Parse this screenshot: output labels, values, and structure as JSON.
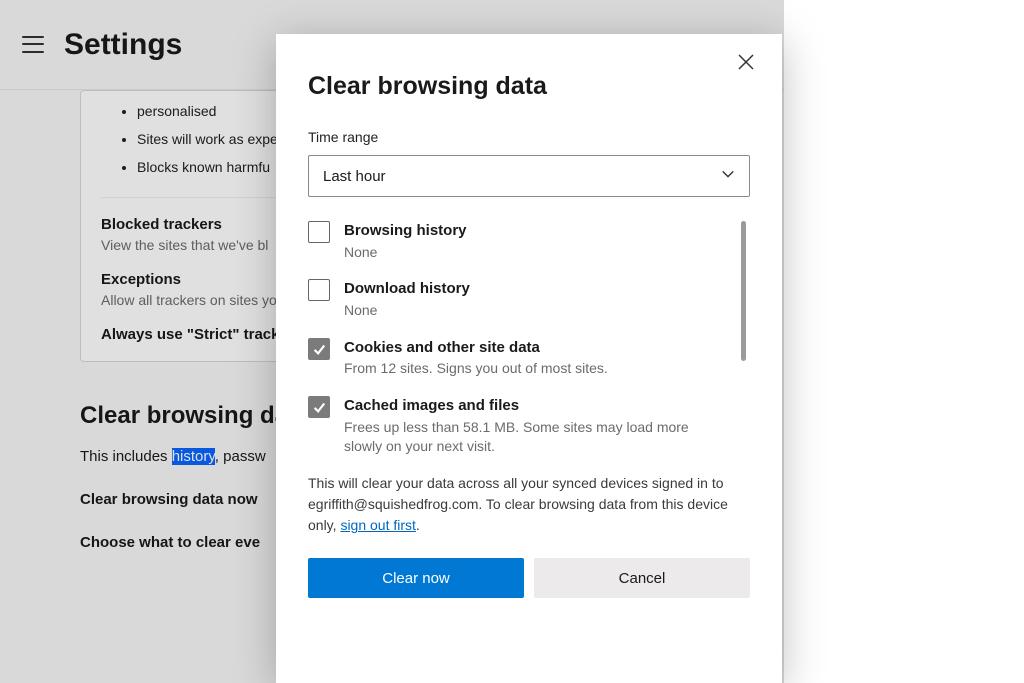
{
  "background": {
    "header_title": "Settings",
    "card": {
      "bullets": [
        "personalised",
        "Sites will work as expe",
        "Blocks known harmfu"
      ],
      "rows": [
        {
          "title": "Blocked trackers",
          "sub": "View the sites that we've bl"
        },
        {
          "title": "Exceptions",
          "sub": "Allow all trackers on sites yo"
        },
        {
          "title": "Always use \"Strict\" track",
          "sub": ""
        }
      ]
    },
    "section_head": "Clear browsing da",
    "para_prefix": "This includes ",
    "para_hl": "history",
    "para_suffix": ", passw",
    "subrow1": "Clear browsing data now",
    "subrow2": "Choose what to clear eve"
  },
  "dialog": {
    "title": "Clear browsing data",
    "time_range_label": "Time range",
    "time_range_value": "Last hour",
    "items": [
      {
        "title": "Browsing history",
        "sub": "None",
        "checked": false
      },
      {
        "title": "Download history",
        "sub": "None",
        "checked": false
      },
      {
        "title": "Cookies and other site data",
        "sub": "From 12 sites. Signs you out of most sites.",
        "checked": true
      },
      {
        "title": "Cached images and files",
        "sub": "Frees up less than 58.1 MB. Some sites may load more slowly on your next visit.",
        "checked": true
      }
    ],
    "sync_note_1": "This will clear your data across all your synced devices signed in to egriffith@squishedfrog.com. To clear browsing data from this device only, ",
    "sync_note_link": "sign out first",
    "sync_note_2": ".",
    "primary": "Clear now",
    "secondary": "Cancel"
  }
}
